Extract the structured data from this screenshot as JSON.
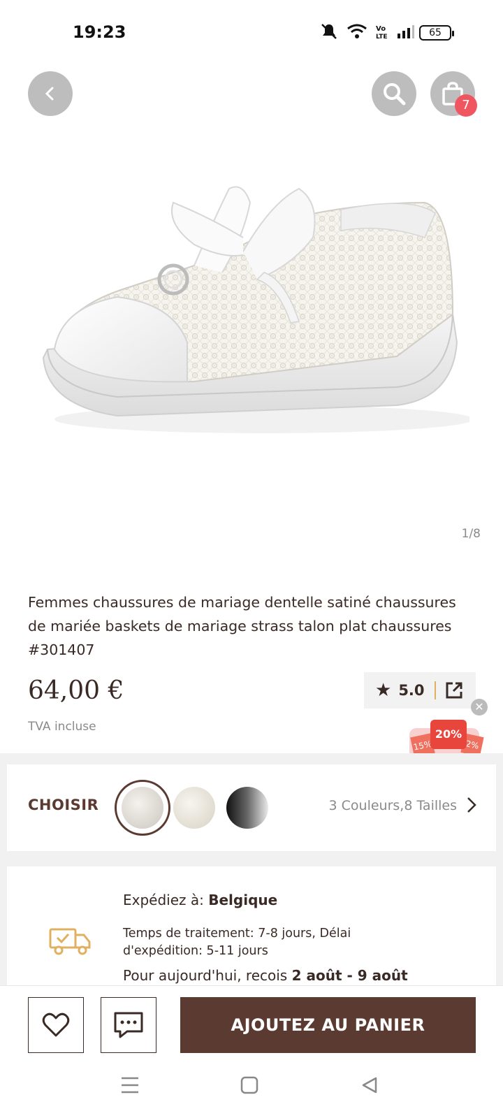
{
  "status_bar": {
    "time": "19:23",
    "battery": "65"
  },
  "header": {
    "cart_count": "7"
  },
  "gallery": {
    "counter": "1/8"
  },
  "product": {
    "title": "Femmes chaussures de mariage dentelle satiné chaussures de mariée baskets de mariage strass talon plat chaussures  #301407",
    "price": "64,00 €",
    "tva": "TVA incluse",
    "rating": "5.0"
  },
  "promo": {
    "main": "20%",
    "left": "15%",
    "right": "2%"
  },
  "variants": {
    "label": "CHOISIR",
    "summary": "3 Couleurs,8 Tailles",
    "swatches": [
      "ivory-lace",
      "ivory-lace-light",
      "black-gradient"
    ]
  },
  "shipping": {
    "ship_to_label": "Expédiez à: ",
    "country": "Belgique",
    "processing": "Temps de traitement: 7-8  jours, Délai d'expédition: 5-11 jours",
    "delivery_label": "Pour aujourd'hui, recois ",
    "delivery_dates": "2 août - 9 août"
  },
  "actions": {
    "add_to_cart": "AJOUTEZ AU PANIER"
  },
  "colors": {
    "brand": "#5b3a31",
    "badge": "#f0565f",
    "accent_gold": "#e0b060"
  }
}
